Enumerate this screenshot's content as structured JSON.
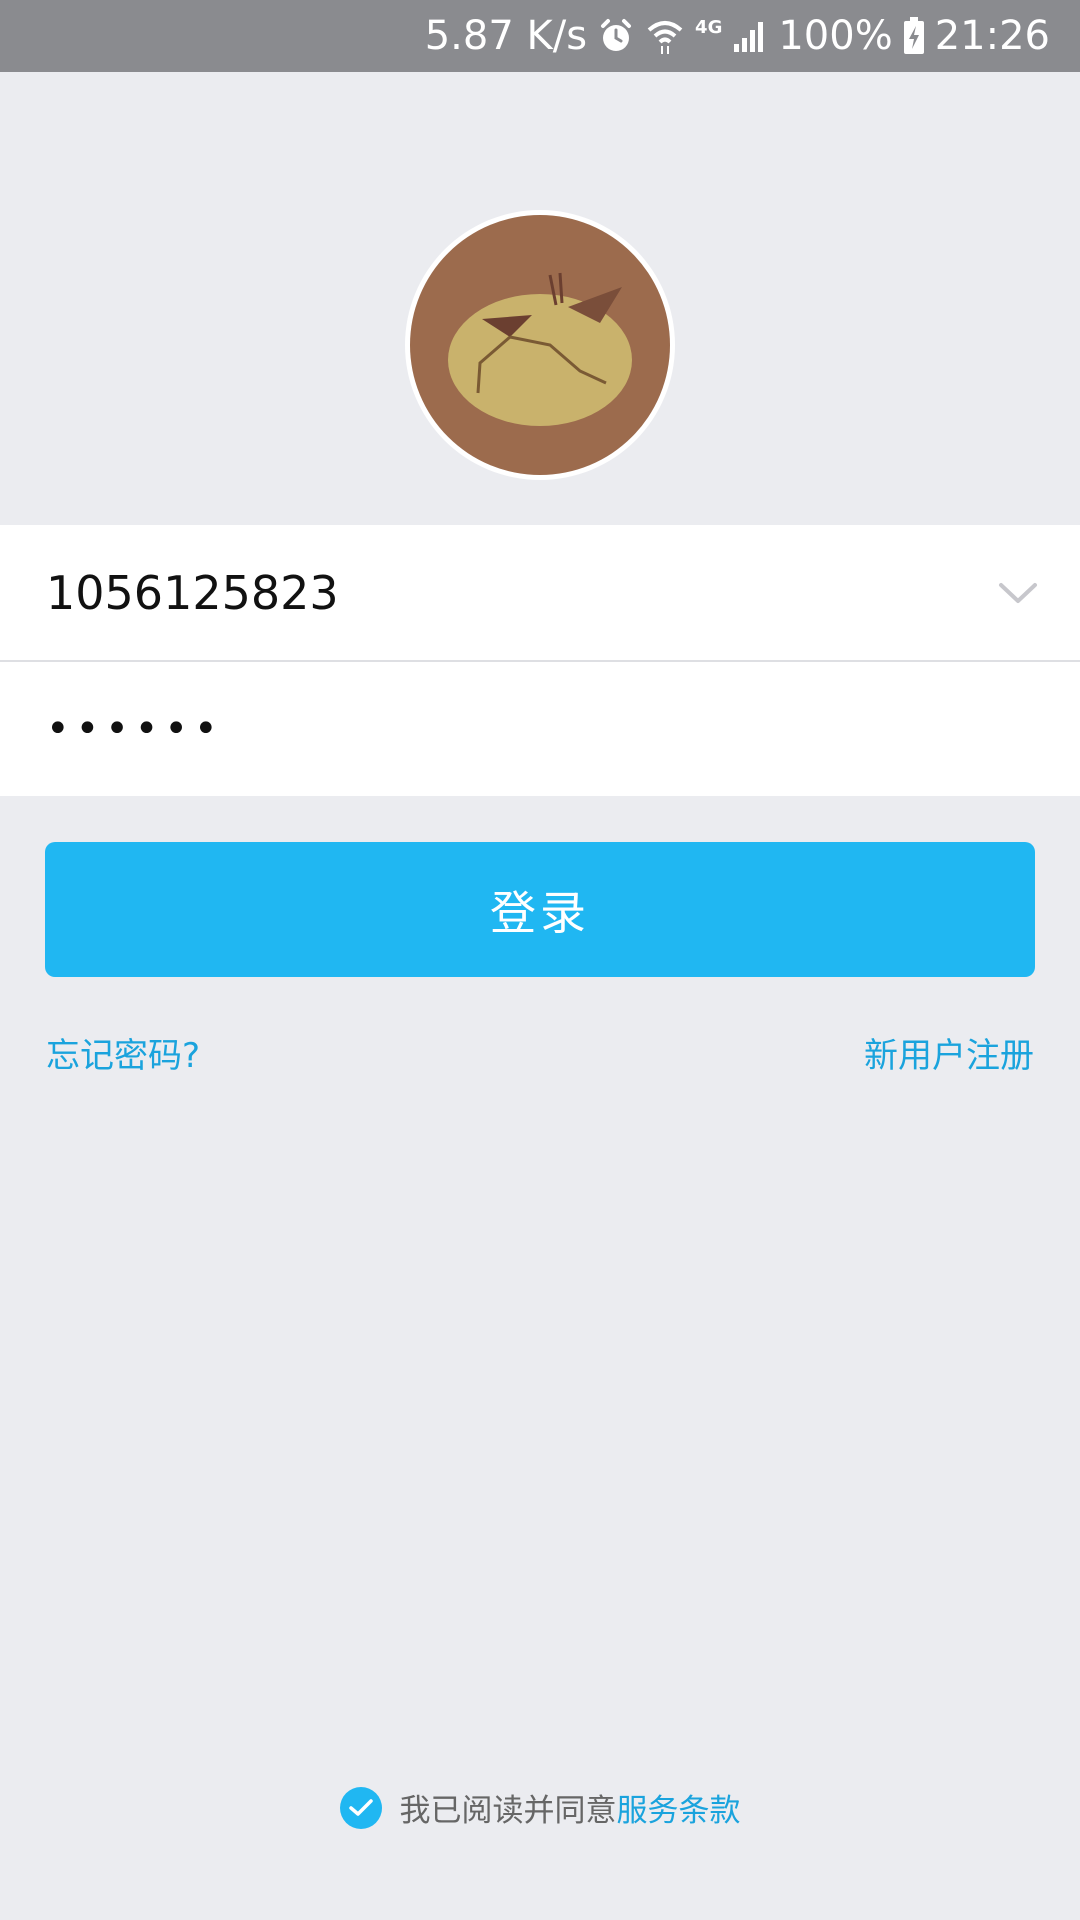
{
  "status_bar": {
    "net_speed": "5.87 K/s",
    "network_type": "4G",
    "battery": "100%",
    "time": "21:26"
  },
  "avatar": {
    "icon": "bear-face-icon"
  },
  "login_form": {
    "account_value": "1056125823",
    "password_mask": "••••••",
    "login_label": "登录"
  },
  "links": {
    "forgot_password": "忘记密码?",
    "register": "新用户注册"
  },
  "agreement": {
    "checked": true,
    "text": "我已阅读并同意",
    "terms_link": "服务条款"
  },
  "colors": {
    "accent": "#20b7f2",
    "link": "#1aa3dd",
    "background": "#ebecf0",
    "status_bar": "#8a8b8f"
  }
}
